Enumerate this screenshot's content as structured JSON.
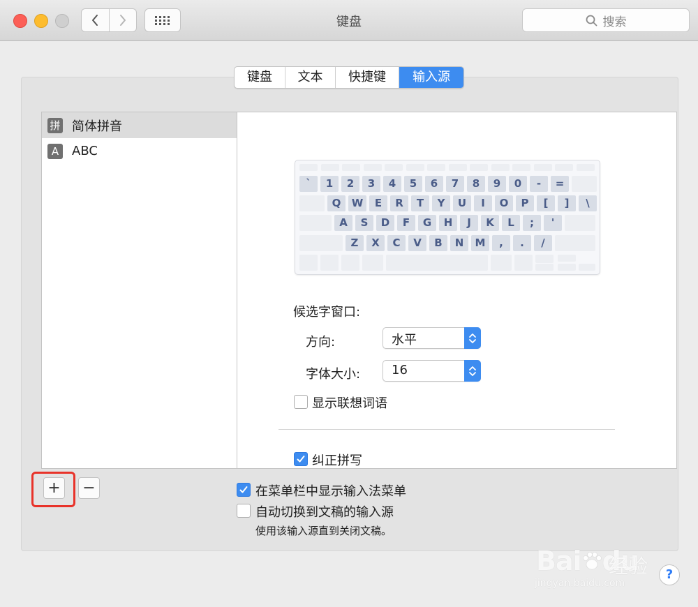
{
  "window": {
    "title": "键盘",
    "search_placeholder": "搜索"
  },
  "tabs": [
    {
      "label": "键盘",
      "active": false
    },
    {
      "label": "文本",
      "active": false
    },
    {
      "label": "快捷键",
      "active": false
    },
    {
      "label": "输入源",
      "active": true
    }
  ],
  "sources": [
    {
      "icon_text": "拼",
      "label": "简体拼音",
      "selected": true
    },
    {
      "icon_text": "A",
      "label": "ABC",
      "selected": false
    }
  ],
  "keyboard": {
    "row1": [
      "`",
      "1",
      "2",
      "3",
      "4",
      "5",
      "6",
      "7",
      "8",
      "9",
      "0",
      "-",
      "="
    ],
    "row2": [
      "Q",
      "W",
      "E",
      "R",
      "T",
      "Y",
      "U",
      "I",
      "O",
      "P",
      "[",
      "]",
      "\\"
    ],
    "row3": [
      "A",
      "S",
      "D",
      "F",
      "G",
      "H",
      "J",
      "K",
      "L",
      ";",
      "'"
    ],
    "row4": [
      "Z",
      "X",
      "C",
      "V",
      "B",
      "N",
      "M",
      ",",
      ".",
      "/"
    ]
  },
  "candidate_window": {
    "title": "候选字窗口:",
    "direction_label": "方向:",
    "direction_value": "水平",
    "font_size_label": "字体大小:",
    "font_size_value": "16",
    "show_predictions_label": "显示联想词语",
    "show_predictions_checked": false
  },
  "autocorrect": {
    "label": "纠正拼写",
    "checked": true
  },
  "menu_bar_option": {
    "label": "在菜单栏中显示输入法菜单",
    "checked": true
  },
  "auto_switch_option": {
    "label": "自动切换到文稿的输入源",
    "checked": false,
    "description": "使用该输入源直到关闭文稿。"
  },
  "buttons": {
    "add": "+",
    "remove": "−",
    "help": "?"
  },
  "watermark": {
    "brand": "Bai",
    "brand2": "du",
    "cn": "经验",
    "url": "jingyan.baidu.com"
  },
  "colors": {
    "accent": "#3d8cf0",
    "highlight": "#e8332a"
  }
}
